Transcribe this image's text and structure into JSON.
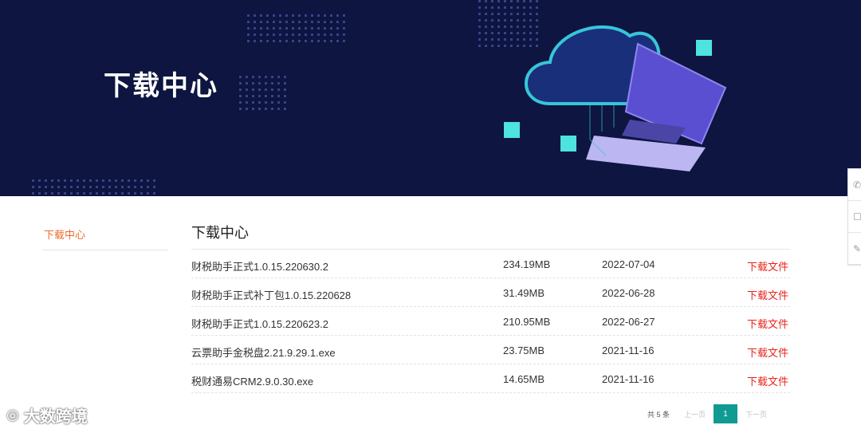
{
  "banner": {
    "title": "下载中心"
  },
  "sidebar": {
    "items": [
      {
        "label": "下载中心"
      }
    ]
  },
  "main": {
    "title": "下载中心",
    "files": [
      {
        "name": "财税助手正式1.0.15.220630.2",
        "size": "234.19MB",
        "date": "2022-07-04",
        "action": "下载文件"
      },
      {
        "name": "财税助手正式补丁包1.0.15.220628",
        "size": "31.49MB",
        "date": "2022-06-28",
        "action": "下载文件"
      },
      {
        "name": "财税助手正式1.0.15.220623.2",
        "size": "210.95MB",
        "date": "2022-06-27",
        "action": "下载文件"
      },
      {
        "name": "云票助手金税盘2.21.9.29.1.exe",
        "size": "23.75MB",
        "date": "2021-11-16",
        "action": "下载文件"
      },
      {
        "name": "税财通易CRM2.9.0.30.exe",
        "size": "14.65MB",
        "date": "2021-11-16",
        "action": "下载文件"
      }
    ]
  },
  "pagination": {
    "total": "共 5 条",
    "prev": "上一页",
    "current": "1",
    "next": "下一页"
  },
  "side_float": {
    "icons": [
      "phone-icon",
      "chat-icon",
      "edit-icon"
    ]
  },
  "watermark": {
    "text": "大数跨境"
  },
  "colors": {
    "banner_bg": "#0d1540",
    "accent_orange": "#ee6b2d",
    "link_red": "#e8231a",
    "page_active": "#0f9a92"
  }
}
